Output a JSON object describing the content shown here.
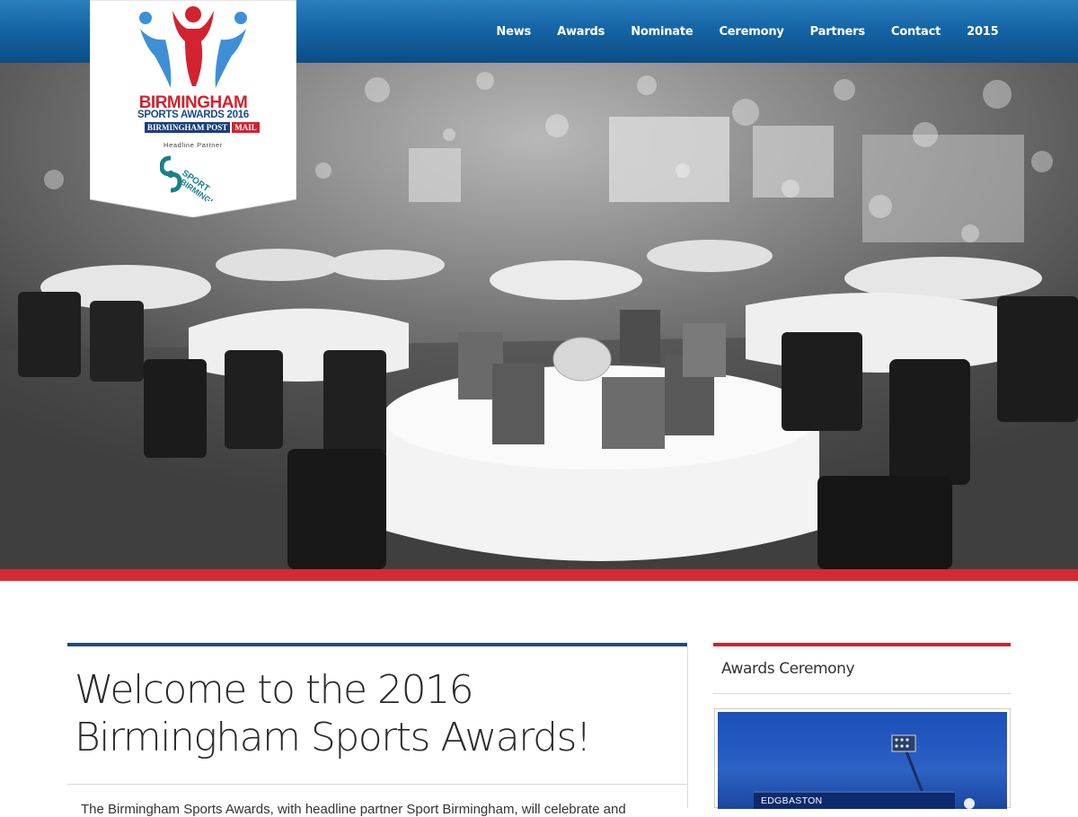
{
  "header": {
    "nav": [
      "News",
      "Awards",
      "Nominate",
      "Ceremony",
      "Partners",
      "Contact",
      "2015"
    ]
  },
  "logo": {
    "line1": "BIRMINGHAM",
    "line2": "SPORTS AWARDS 2016",
    "paper1": "BIRMINGHAM POST",
    "paper2": "MAIL",
    "partner_label": "Headline Partner",
    "partner_name": "SPORT BIRMINGHAM"
  },
  "main": {
    "headline": "Welcome to the 2016 Birmingham Sports Awards!",
    "intro": "The Birmingham Sports Awards, with headline partner Sport Birmingham, will celebrate and"
  },
  "sidebar": {
    "title": "Awards Ceremony",
    "venue_label": "EDGBASTON"
  },
  "colors": {
    "header_blue": "#1565a6",
    "accent_red": "#d42a34",
    "rule_navy": "#1d4b79"
  }
}
